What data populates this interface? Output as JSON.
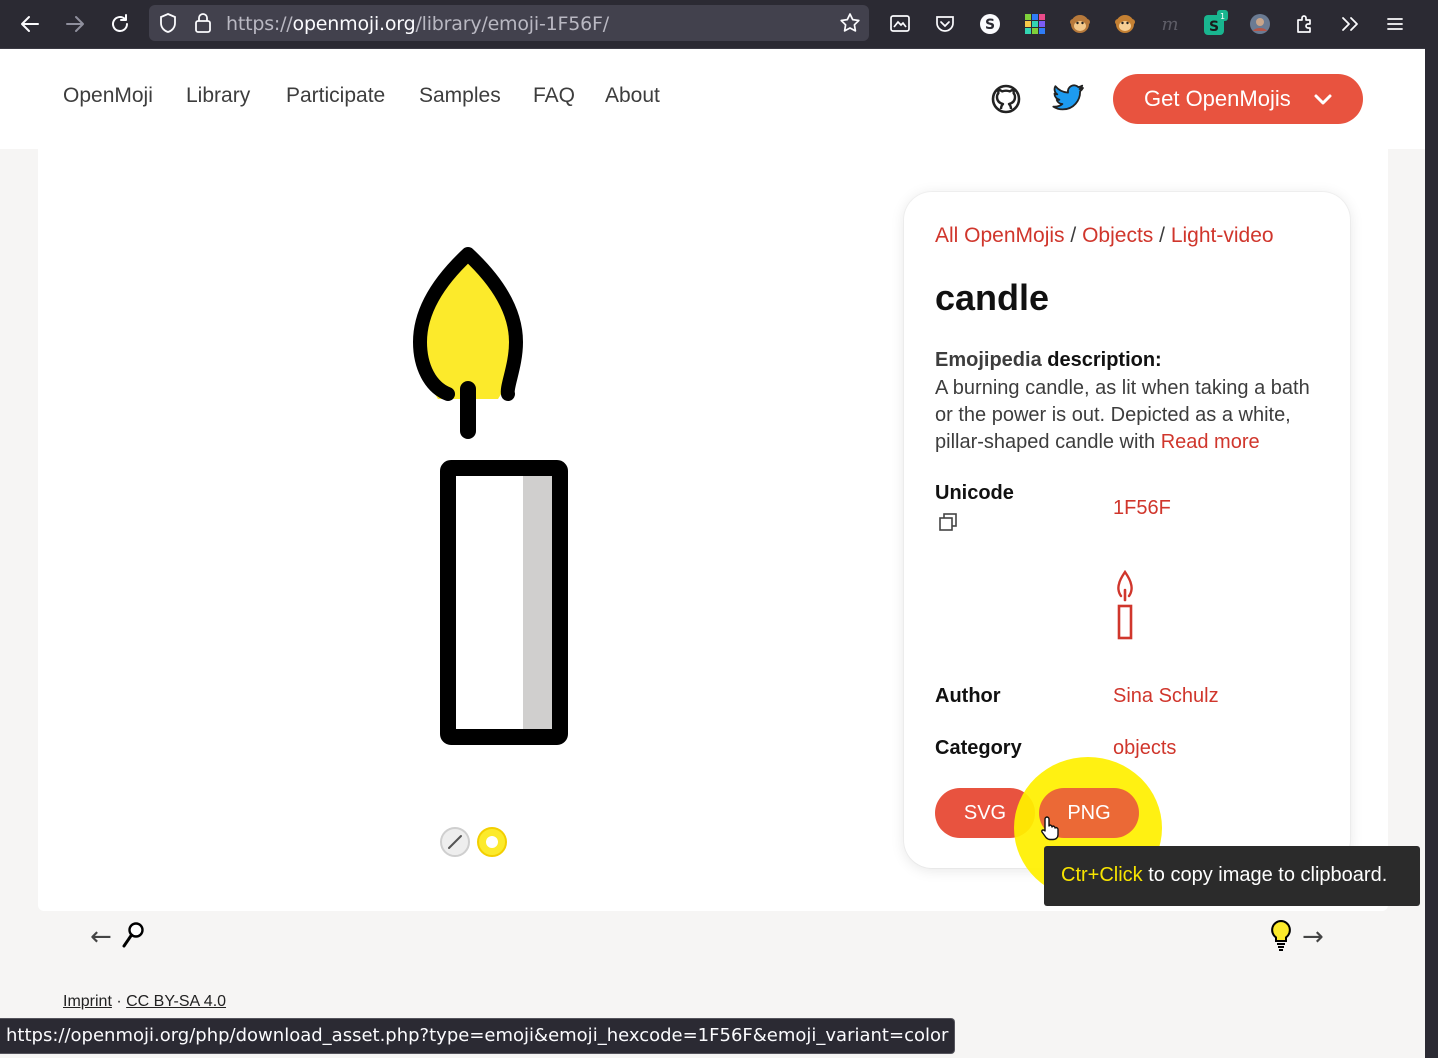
{
  "browser": {
    "url_prefix": "https://",
    "url_host": "openmoji.org",
    "url_path": "/library/emoji-1F56F/",
    "extension_badge": "1",
    "status_url": "https://openmoji.org/php/download_asset.php?type=emoji&emoji_hexcode=1F56F&emoji_variant=color"
  },
  "nav": {
    "items": [
      "OpenMoji",
      "Library",
      "Participate",
      "Samples",
      "FAQ",
      "About"
    ],
    "get_button": "Get OpenMojis"
  },
  "emoji": {
    "breadcrumb": [
      "All OpenMojis",
      "Objects",
      "Light-video"
    ],
    "breadcrumb_sep": "/",
    "name": "candle",
    "desc_source": "Emojipedia",
    "desc_label": "description:",
    "description": "A burning candle, as lit when taking a bath or the power is out. Depicted as a white, pillar-shaped candle with ",
    "read_more": "Read more",
    "unicode_label": "Unicode",
    "unicode": "1F56F",
    "author_label": "Author",
    "author": "Sina Schulz",
    "category_label": "Category",
    "category": "objects",
    "svg_button": "SVG",
    "png_button": "PNG"
  },
  "tooltip": {
    "key": "Ctr+Click",
    "text": " to copy image to clipboard."
  },
  "footer": {
    "imprint": "Imprint",
    "sep": " · ",
    "license": "CC BY-SA 4.0"
  },
  "colors": {
    "accent": "#e8533f",
    "link": "#d0362c",
    "flame": "#fcea2b",
    "candle_shade": "#d0cfce",
    "browser_bg": "#2b2a33"
  }
}
